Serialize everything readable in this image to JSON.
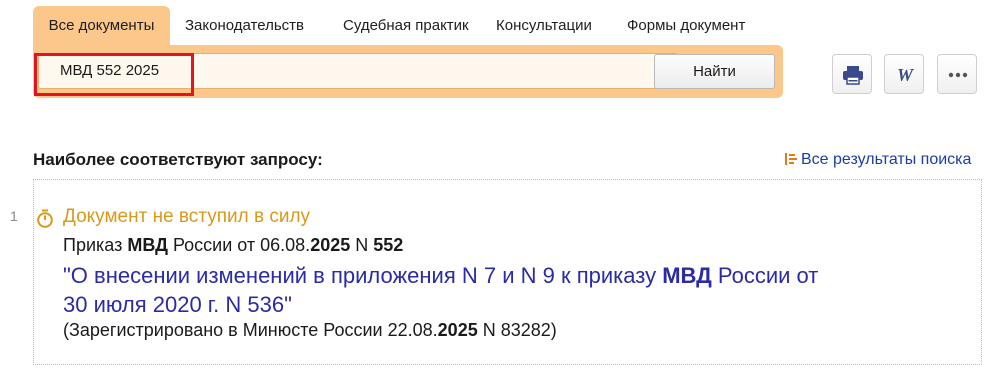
{
  "tabs": [
    {
      "label": "Все документы",
      "active": true
    },
    {
      "label": "Законодательств",
      "active": false
    },
    {
      "label": "Судебная практик",
      "active": false
    },
    {
      "label": "Консультации",
      "active": false
    },
    {
      "label": "Формы документ",
      "active": false
    }
  ],
  "search": {
    "query": "МВД 552 2025",
    "clear_icon": "×",
    "button_label": "Найти"
  },
  "toolbar": {
    "print_icon": "printer-icon",
    "word_icon": "word-export-icon",
    "more_icon": "more-icon"
  },
  "results": {
    "heading": "Наиболее соответствуют запросу:",
    "all_results_label": "Все результаты поиска",
    "items": [
      {
        "number": "1",
        "status": "Документ не вступил в силу",
        "meta": {
          "prefix": "Приказ ",
          "kw1": "МВД",
          "mid": " России от 06.08.",
          "kw2": "2025",
          "mid2": " N ",
          "kw3": "552"
        },
        "title": {
          "part1": "\"О внесении изменений в приложения N 7 и N 9 к приказу ",
          "kw": "МВД",
          "part2": " России от",
          "line2": "30 июля 2020 г. N 536\""
        },
        "registration": {
          "prefix": "(Зарегистрировано в Минюсте России 22.08.",
          "kw": "2025",
          "suffix": " N 83282)"
        }
      }
    ]
  },
  "colors": {
    "accent": "#fbc78a",
    "link": "#2b2ba6",
    "status": "#d89a1a",
    "highlight": "#e3151c"
  }
}
